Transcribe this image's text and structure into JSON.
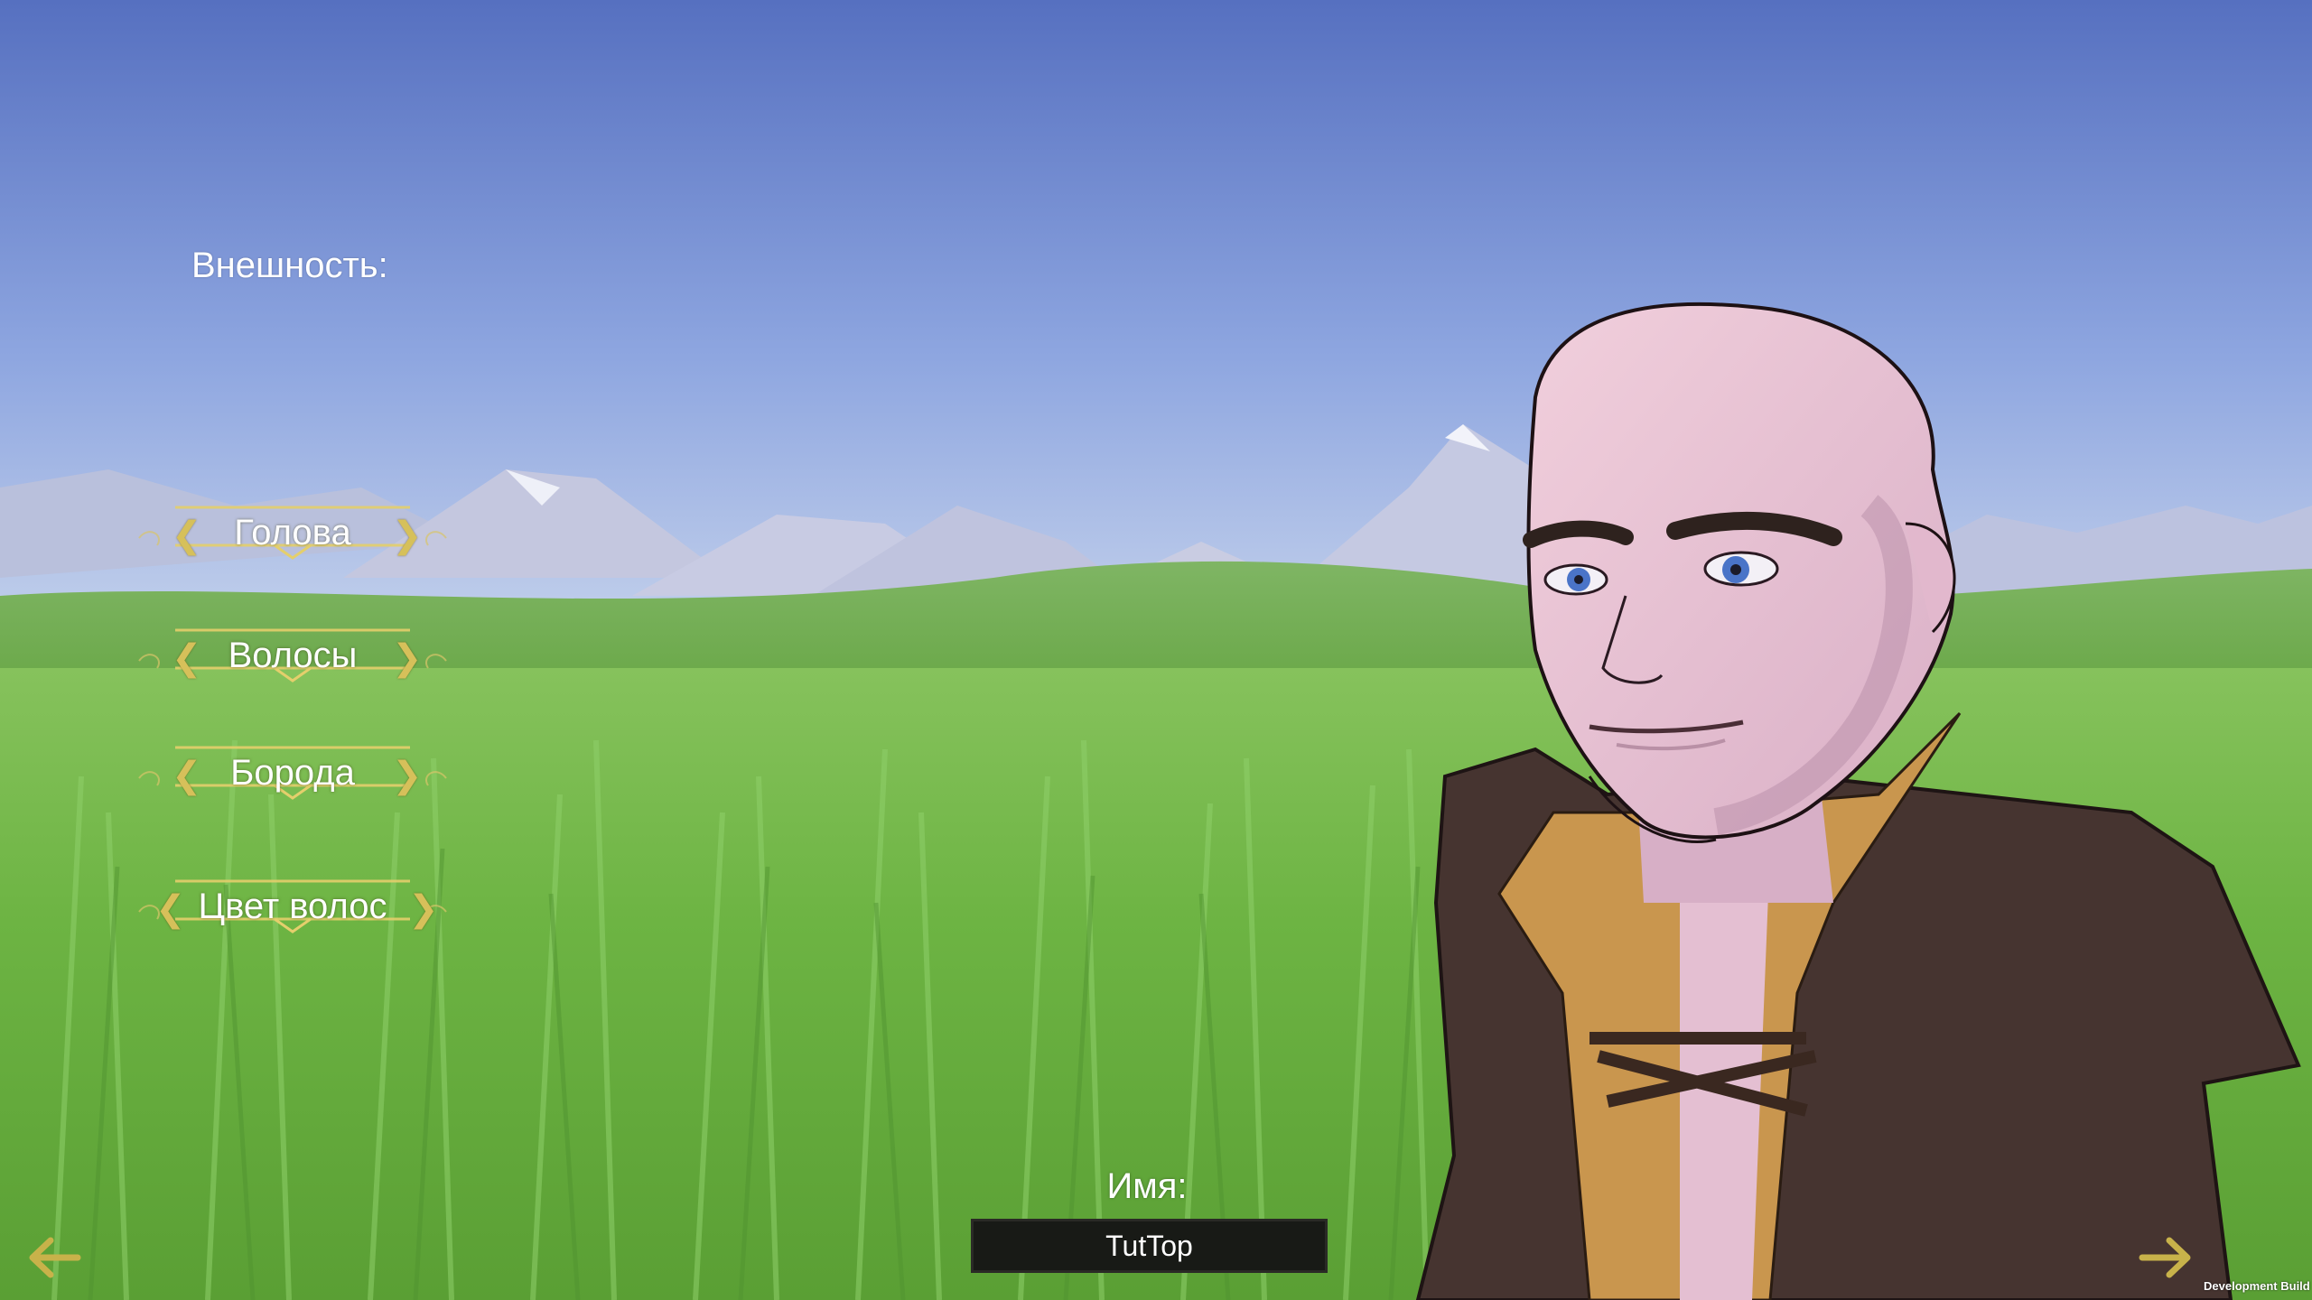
{
  "appearance": {
    "title": "Внешность:",
    "options": [
      {
        "label": "Голова",
        "prev": "❮",
        "next": "❯"
      },
      {
        "label": "Волосы",
        "prev": "❮",
        "next": "❯"
      },
      {
        "label": "Борода",
        "prev": "❮",
        "next": "❯"
      },
      {
        "label": "Цвет волос",
        "prev": "❮",
        "next": "❯"
      }
    ]
  },
  "name": {
    "label": "Имя:",
    "value": "TutTop"
  },
  "footer": {
    "build_label": "Development Build"
  },
  "colors": {
    "accent_gold": "#d6c05a",
    "input_bg": "#181a16"
  },
  "icons": {
    "back": "arrow-left-icon",
    "next": "arrow-right-icon"
  }
}
